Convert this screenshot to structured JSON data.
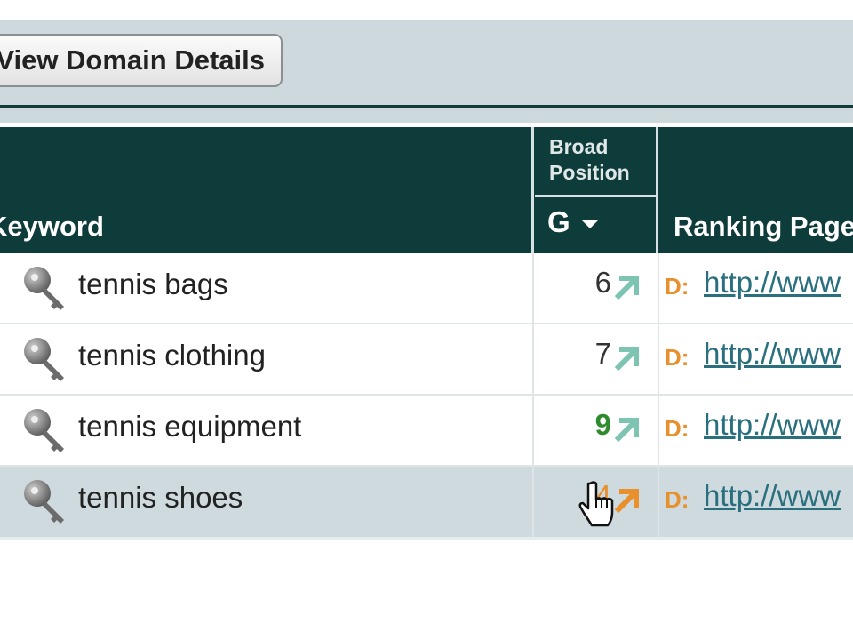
{
  "toolbar": {
    "domain_button_label": "View Domain Details"
  },
  "table": {
    "headers": {
      "keyword": "Keyword",
      "broad_position": "Broad Position",
      "engine": "G",
      "ranking_page": "Ranking Page"
    },
    "rows": [
      {
        "keyword": "tennis bags",
        "position": "6",
        "trend": "up",
        "d_label": "D:",
        "url": "http://www"
      },
      {
        "keyword": "tennis clothing",
        "position": "7",
        "trend": "up",
        "d_label": "D:",
        "url": "http://www"
      },
      {
        "keyword": "tennis equipment",
        "position": "9",
        "trend": "up",
        "d_label": "D:",
        "url": "http://www"
      },
      {
        "keyword": "tennis shoes",
        "position": "4",
        "trend": "up",
        "d_label": "D:",
        "url": "http://www"
      }
    ]
  },
  "colors": {
    "header_bg": "#0e3c3a",
    "toolbar_bg": "#ced9de",
    "trend_up_teal": "#7ec4b2",
    "trend_up_orange": "#e8902c",
    "highlight_row": "#cfdade",
    "link": "#2a6f7e"
  },
  "icons": {
    "keyword_icon": "key-icon",
    "trend_icon": "arrow-up-right-icon",
    "sort_icon": "caret-down-icon",
    "cursor": "hand-pointer-cursor"
  }
}
